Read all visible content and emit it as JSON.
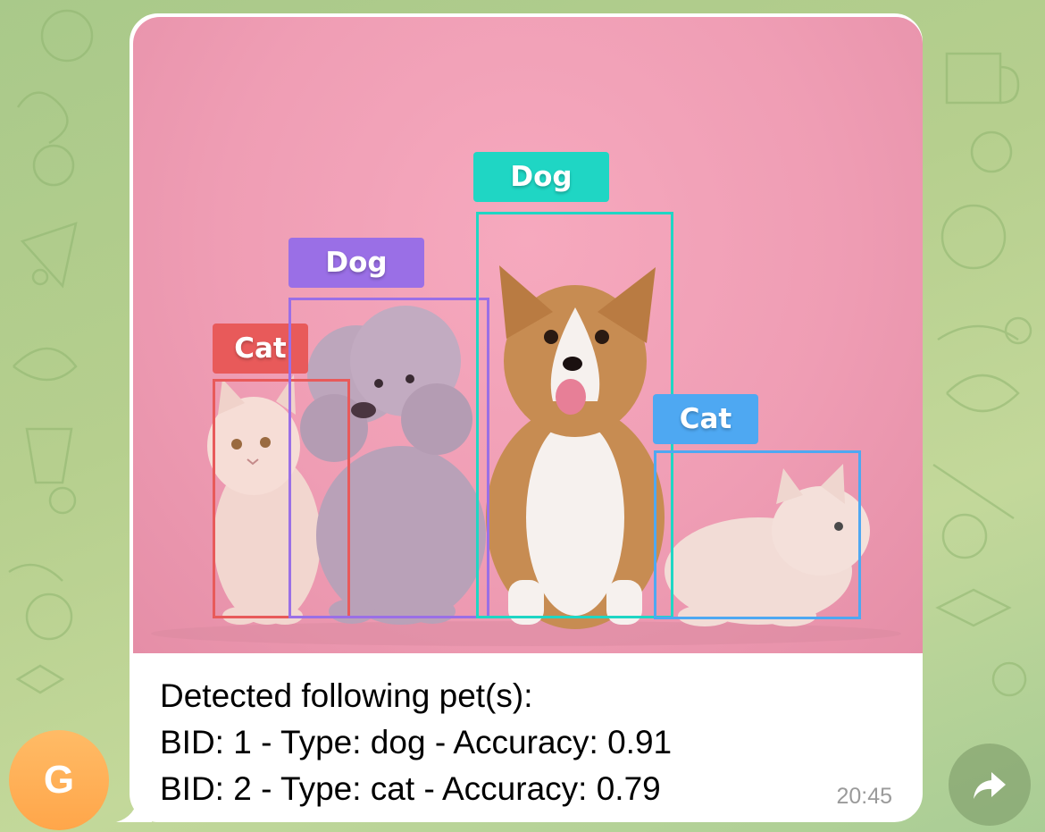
{
  "message": {
    "detections": [
      {
        "label": "Cat",
        "color": "#e85a5a"
      },
      {
        "label": "Dog",
        "color": "#9a6fe6"
      },
      {
        "label": "Dog",
        "color": "#1fd6c4"
      },
      {
        "label": "Cat",
        "color": "#4ea8f2"
      }
    ],
    "caption": {
      "line1": "Detected following pet(s):",
      "line2": "BID: 1 - Type: dog - Accuracy: 0.91",
      "line3": "BID: 2 - Type: cat - Accuracy: 0.79"
    },
    "time": "20:45"
  },
  "sender": {
    "avatar_initial": "G",
    "avatar_color": "#ffa64a"
  },
  "actions": {
    "forward_icon": "forward-arrow-icon"
  }
}
